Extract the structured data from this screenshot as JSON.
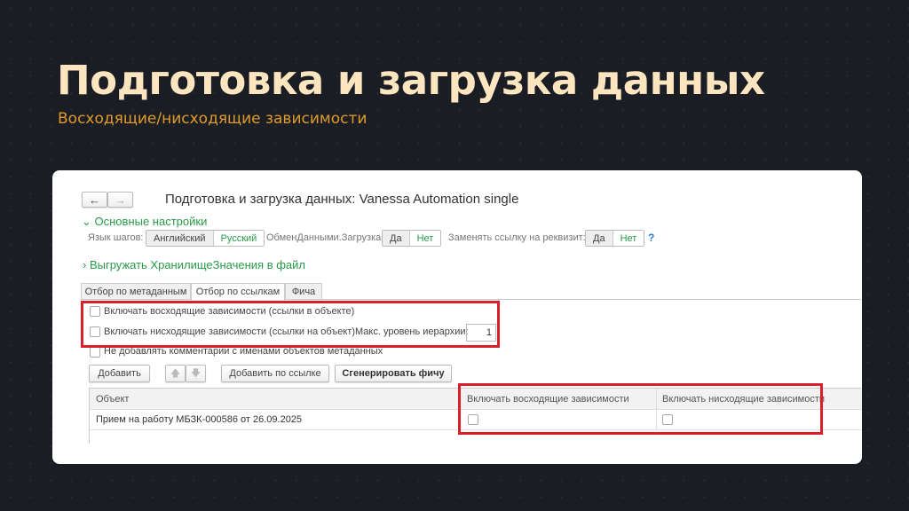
{
  "slide": {
    "title": "Подготовка и загрузка данных",
    "subtitle": "Восходящие/нисходящие зависимости"
  },
  "window": {
    "title": "Подготовка и загрузка данных: Vanessa Automation single",
    "back": "←",
    "forward": "→"
  },
  "main_settings": {
    "label": "Основные настройки",
    "step_lang_label": "Язык шагов:",
    "lang_options": [
      "Английский",
      "Русский"
    ],
    "exchange_label": "ОбменДанными.Загрузка:",
    "replace_label": "Заменять ссылку на реквизит:",
    "yes": "Да",
    "no": "Нет",
    "help": "?"
  },
  "export_section": "Выгружать ХранилищеЗначения в файл",
  "tabs": [
    "Отбор по метаданным",
    "Отбор по ссылкам",
    "Фича"
  ],
  "options": {
    "upward": "Включать восходящие зависимости (ссылки в объекте)",
    "downward": "Включать нисходящие зависимости (ссылки на объект)",
    "max_level_label": "Макс. уровень иерархии:",
    "max_level": "1",
    "no_comments": "Не добавлять комментарии с именами объектов метаданных"
  },
  "toolbar": {
    "add": "Добавить",
    "up": "🡅",
    "down": "🡇",
    "add_by_ref": "Добавить по ссылке",
    "generate": "Сгенерировать фичу"
  },
  "table": {
    "columns": [
      "Объект",
      "Включать восходящие зависимости",
      "Включать нисходящие зависимости"
    ],
    "rows": [
      {
        "object": "Прием на работу МБЗК-000586 от 26.09.2025"
      }
    ]
  }
}
